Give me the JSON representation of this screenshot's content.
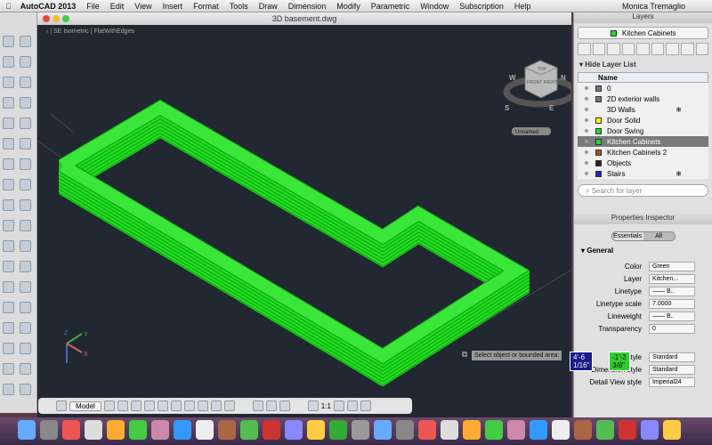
{
  "menubar": {
    "app": "AutoCAD 2013",
    "items": [
      "File",
      "Edit",
      "View",
      "Insert",
      "Format",
      "Tools",
      "Draw",
      "Dimension",
      "Modify",
      "Parametric",
      "Window",
      "Subscription",
      "Help"
    ],
    "user": "Monica Tremaglio"
  },
  "document": {
    "title": "3D basement.dwg",
    "view": "SE Isometric",
    "visual_style": "FlatWithEdges",
    "viewcube_faces": [
      "TOP",
      "FRONT",
      "RIGHT"
    ],
    "compass": [
      "W",
      "N",
      "S",
      "E"
    ],
    "ucs_name": "Unnamed",
    "prompt": "Select object or bounded area:",
    "dim_input_1": "4'-6 1/16\"",
    "dim_input_2": "-1'-2 3/8\"",
    "wall_color": "#1fdc1f"
  },
  "statusbar": {
    "model": "Model",
    "scale": "1:1"
  },
  "layers": {
    "title": "Layers",
    "current": "Kitchen Cabinets",
    "hide": "Hide Layer List",
    "name_header": "Name",
    "search_placeholder": "Search for layer",
    "list": [
      {
        "name": "0",
        "color": "#777777"
      },
      {
        "name": "2D exterior walls",
        "color": "#777777"
      },
      {
        "name": "3D Walls",
        "color": "",
        "frozen": "❄"
      },
      {
        "name": "Door Solid",
        "color": "#ffff00"
      },
      {
        "name": "Door Swing",
        "color": "#22dd22"
      },
      {
        "name": "Kitchen Cabinets",
        "color": "#22dd22",
        "selected": true
      },
      {
        "name": "Kitchen Cabinets 2",
        "color": "#a0521d"
      },
      {
        "name": "Objects",
        "color": "#222222"
      },
      {
        "name": "Stairs",
        "color": "#2222cc",
        "frozen": "❄"
      }
    ]
  },
  "props": {
    "title": "Properties Inspector",
    "tabs": [
      "Essentials",
      "All"
    ],
    "section": "General",
    "rows": [
      {
        "k": "Color",
        "v": "Green"
      },
      {
        "k": "Layer",
        "v": "Kitchen..."
      },
      {
        "k": "Linetype",
        "v": "—— B.."
      },
      {
        "k": "Linetype scale",
        "v": "7.0000"
      },
      {
        "k": "Lineweight",
        "v": "—— B.."
      },
      {
        "k": "Transparency",
        "v": "0"
      }
    ],
    "rows2": [
      {
        "k": "Text style",
        "v": "Standard"
      },
      {
        "k": "Dimension style",
        "v": "Standard"
      },
      {
        "k": "Detail View style",
        "v": "Imperial24"
      }
    ]
  }
}
